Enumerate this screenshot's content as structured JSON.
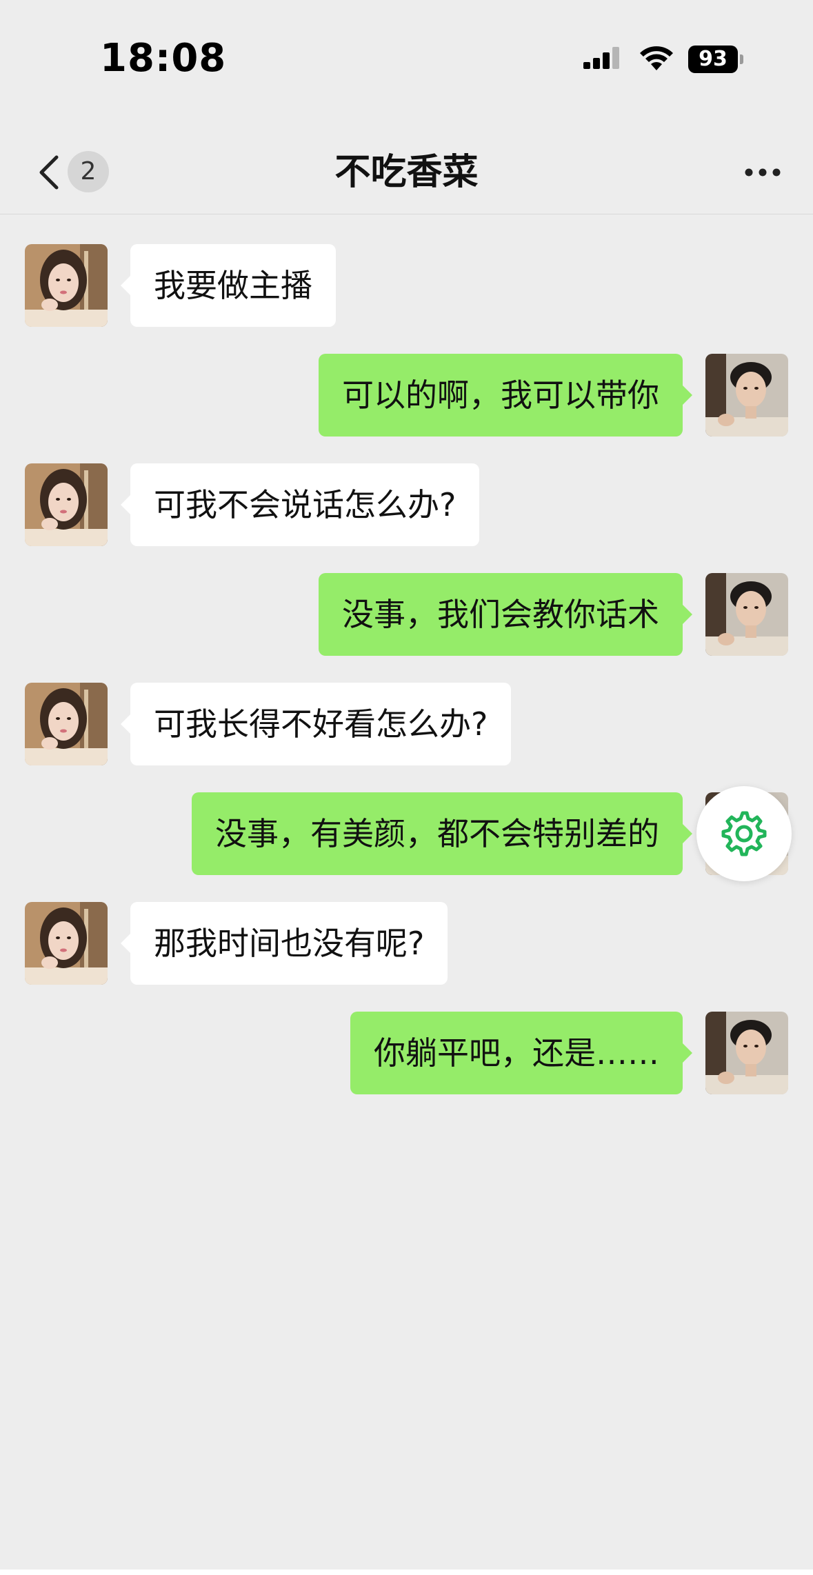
{
  "status_bar": {
    "time": "18:08",
    "battery": "93",
    "icons": [
      "cellular-signal-icon",
      "wifi-icon",
      "battery-icon"
    ]
  },
  "nav": {
    "title": "不吃香菜",
    "unread_count": "2",
    "icons": [
      "back-chevron-icon",
      "more-dots-icon"
    ]
  },
  "messages": [
    {
      "side": "left",
      "text": "我要做主播"
    },
    {
      "side": "right",
      "text": "可以的啊，我可以带你"
    },
    {
      "side": "left",
      "text": "可我不会说话怎么办?"
    },
    {
      "side": "right",
      "text": "没事，我们会教你话术"
    },
    {
      "side": "left",
      "text": "可我长得不好看怎么办?"
    },
    {
      "side": "right",
      "text": "没事，有美颜，都不会特别差的"
    },
    {
      "side": "left",
      "text": "那我时间也没有呢?"
    },
    {
      "side": "right",
      "text": "你躺平吧，还是……"
    }
  ],
  "floating_button": {
    "icon": "settings-gear-icon"
  },
  "colors": {
    "background": "#ededed",
    "outgoing_bubble": "#95ec69",
    "incoming_bubble": "#ffffff",
    "gear_accent": "#22b55a"
  }
}
